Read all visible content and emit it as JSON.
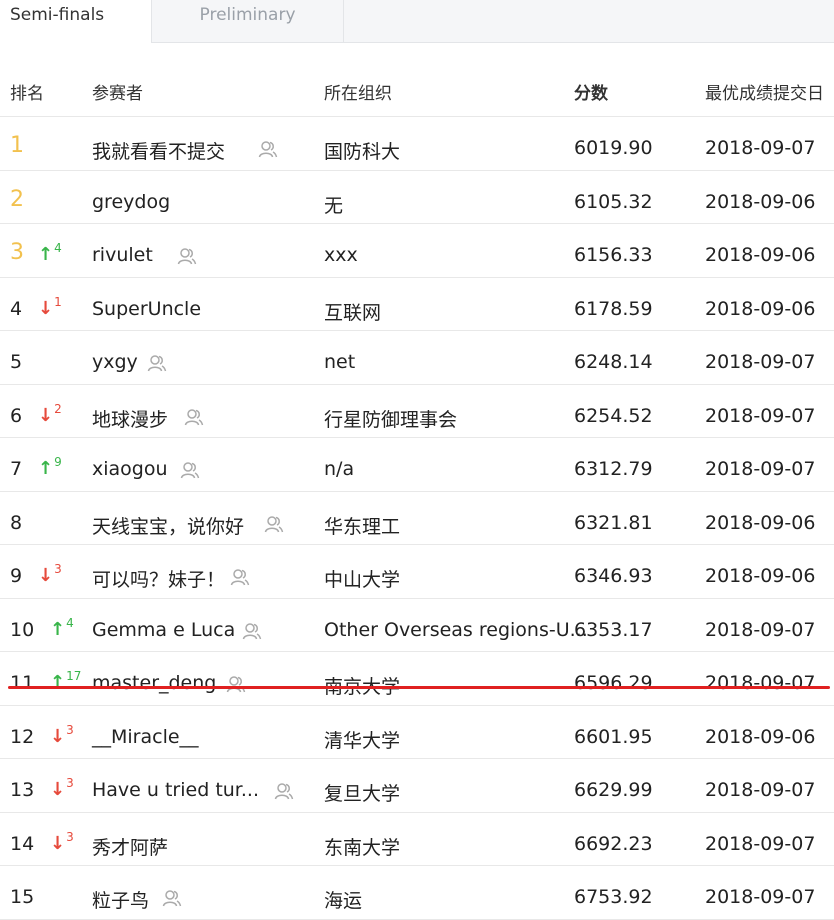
{
  "tabs": [
    {
      "label": "Semi-finals",
      "active": true
    },
    {
      "label": "Preliminary",
      "active": false
    }
  ],
  "headers": {
    "rank": "排名",
    "participant": "参赛者",
    "organization": "所在组织",
    "score": "分数",
    "date": "最优成绩提交日"
  },
  "rows": [
    {
      "rank": "1",
      "name": "我就看看不提交",
      "org": "国防科大",
      "score": "6019.90",
      "date": "2018-09-07",
      "team": true,
      "trend": null,
      "change": ""
    },
    {
      "rank": "2",
      "name": "greydog",
      "org": "无",
      "score": "6105.32",
      "date": "2018-09-06",
      "team": false,
      "trend": null,
      "change": ""
    },
    {
      "rank": "3",
      "name": "rivulet",
      "org": "xxx",
      "score": "6156.33",
      "date": "2018-09-06",
      "team": true,
      "trend": "up",
      "change": "4"
    },
    {
      "rank": "4",
      "name": "SuperUncle",
      "org": "互联网",
      "score": "6178.59",
      "date": "2018-09-06",
      "team": false,
      "trend": "down",
      "change": "1"
    },
    {
      "rank": "5",
      "name": "yxgy",
      "org": "net",
      "score": "6248.14",
      "date": "2018-09-07",
      "team": true,
      "trend": null,
      "change": ""
    },
    {
      "rank": "6",
      "name": "地球漫步",
      "org": "行星防御理事会",
      "score": "6254.52",
      "date": "2018-09-07",
      "team": true,
      "trend": "down",
      "change": "2"
    },
    {
      "rank": "7",
      "name": "xiaogou",
      "org": "n/a",
      "score": "6312.79",
      "date": "2018-09-07",
      "team": true,
      "trend": "up",
      "change": "9"
    },
    {
      "rank": "8",
      "name": "天线宝宝，说你好",
      "org": "华东理工",
      "score": "6321.81",
      "date": "2018-09-06",
      "team": true,
      "trend": null,
      "change": ""
    },
    {
      "rank": "9",
      "name": "可以吗？妹子！",
      "org": "中山大学",
      "score": "6346.93",
      "date": "2018-09-06",
      "team": true,
      "trend": "down",
      "change": "3"
    },
    {
      "rank": "10",
      "name": "Gemma e Luca",
      "org": "Other Overseas regions-U...",
      "score": "6353.17",
      "date": "2018-09-07",
      "team": true,
      "trend": "up",
      "change": "4"
    },
    {
      "rank": "11",
      "name": "master_deng",
      "org": "南京大学",
      "score": "6596.29",
      "date": "2018-09-07",
      "team": true,
      "trend": "up",
      "change": "17"
    },
    {
      "rank": "12",
      "name": "__Miracle__",
      "org": "清华大学",
      "score": "6601.95",
      "date": "2018-09-06",
      "team": false,
      "trend": "down",
      "change": "3"
    },
    {
      "rank": "13",
      "name": "Have u tried tur...",
      "org": "复旦大学",
      "score": "6629.99",
      "date": "2018-09-07",
      "team": true,
      "trend": "down",
      "change": "3"
    },
    {
      "rank": "14",
      "name": "秀才阿萨",
      "org": "东南大学",
      "score": "6692.23",
      "date": "2018-09-07",
      "team": false,
      "trend": "down",
      "change": "3"
    },
    {
      "rank": "15",
      "name": "粒子鸟",
      "org": "海运",
      "score": "6753.92",
      "date": "2018-09-07",
      "team": true,
      "trend": null,
      "change": ""
    }
  ],
  "colors": {
    "gold": "#f2c14e",
    "up": "#39b54a",
    "down": "#e64a3c",
    "highlight_line": "#e02020"
  }
}
